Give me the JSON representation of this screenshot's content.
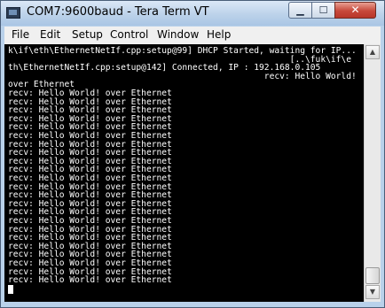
{
  "window": {
    "title": "COM7:9600baud - Tera Term VT",
    "controls": {
      "minimize": "▁",
      "maximize": "☐",
      "close": "✕"
    }
  },
  "menu": {
    "items": [
      "File",
      "Edit",
      "Setup",
      "Control",
      "Window",
      "Help"
    ]
  },
  "terminal": {
    "lines": [
      "k\\if\\eth\\EthernetNetIf.cpp:setup@99] DHCP Started, waiting for IP...",
      "                                                       [..\\fuk\\if\\e",
      "th\\EthernetNetIf.cpp:setup@142] Connected, IP : 192.168.0.105",
      "                                                  recv: Hello World!",
      "over Ethernet",
      "recv: Hello World! over Ethernet",
      "recv: Hello World! over Ethernet",
      "recv: Hello World! over Ethernet",
      "recv: Hello World! over Ethernet",
      "recv: Hello World! over Ethernet",
      "recv: Hello World! over Ethernet",
      "recv: Hello World! over Ethernet",
      "recv: Hello World! over Ethernet",
      "recv: Hello World! over Ethernet",
      "recv: Hello World! over Ethernet",
      "recv: Hello World! over Ethernet",
      "recv: Hello World! over Ethernet",
      "recv: Hello World! over Ethernet",
      "recv: Hello World! over Ethernet",
      "recv: Hello World! over Ethernet",
      "recv: Hello World! over Ethernet",
      "recv: Hello World! over Ethernet",
      "recv: Hello World! over Ethernet",
      "recv: Hello World! over Ethernet",
      "recv: Hello World! over Ethernet",
      "recv: Hello World! over Ethernet",
      "recv: Hello World! over Ethernet",
      "recv: Hello World! over Ethernet"
    ]
  },
  "scrollbar": {
    "up_icon": "▲",
    "down_icon": "▼"
  }
}
